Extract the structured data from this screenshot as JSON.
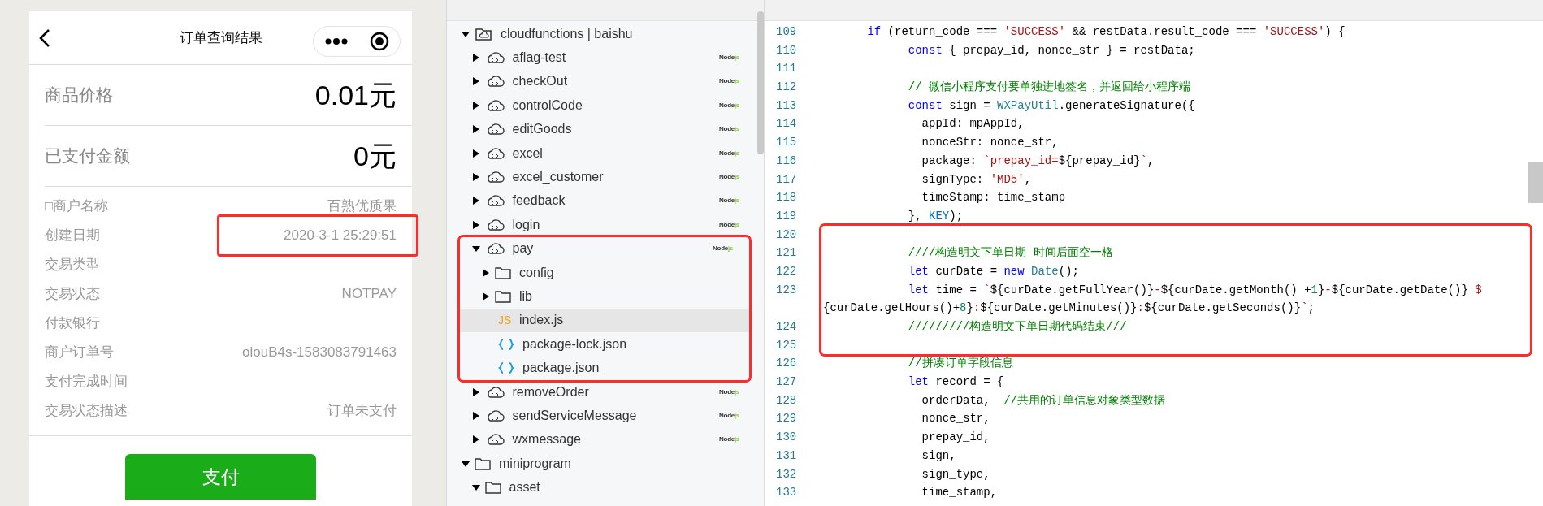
{
  "phone": {
    "title": "订单查询结果",
    "amounts": [
      {
        "label": "商品价格",
        "value": "0.01元"
      },
      {
        "label": "已支付金额",
        "value": "0元"
      }
    ],
    "details": [
      {
        "label": "□商户名称",
        "value": "百熟优质果",
        "highlighted": false
      },
      {
        "label": "创建日期",
        "value": "2020-3-1 25:29:51",
        "highlighted": true
      },
      {
        "label": "交易类型",
        "highlighted": false
      },
      {
        "label": "交易状态",
        "value": "NOTPAY",
        "highlighted": false
      },
      {
        "label": "付款银行",
        "highlighted": false
      },
      {
        "label": "商户订单号",
        "value": "olouB4s-1583083791463",
        "highlighted": false
      },
      {
        "label": "支付完成时间",
        "highlighted": false
      },
      {
        "label": "交易状态描述",
        "value": "订单未支付",
        "highlighted": false
      }
    ],
    "pay_button": "支付"
  },
  "file_tree": [
    {
      "label": "cloudfunctions | baishu",
      "kind": "cloud-root",
      "expanded": true,
      "selected": false,
      "children": [
        {
          "label": "aflag-test",
          "kind": "function",
          "expanded": false,
          "selected": false,
          "highlighted": false,
          "badge": {
            "name": "Node",
            "suffix": "js"
          }
        },
        {
          "label": "checkOut",
          "kind": "function",
          "expanded": false,
          "selected": false,
          "highlighted": false,
          "badge": {
            "name": "Node",
            "suffix": "js"
          }
        },
        {
          "label": "controlCode",
          "kind": "function",
          "expanded": false,
          "selected": false,
          "highlighted": false,
          "badge": {
            "name": "Node",
            "suffix": "js"
          }
        },
        {
          "label": "editGoods",
          "kind": "function",
          "expanded": false,
          "selected": false,
          "highlighted": false,
          "badge": {
            "name": "Node",
            "suffix": "js"
          }
        },
        {
          "label": "excel",
          "kind": "function",
          "expanded": false,
          "selected": false,
          "highlighted": false,
          "badge": {
            "name": "Node",
            "suffix": "js"
          }
        },
        {
          "label": "excel_customer",
          "kind": "function",
          "expanded": false,
          "selected": false,
          "highlighted": false,
          "badge": {
            "name": "Node",
            "suffix": "js"
          }
        },
        {
          "label": "feedback",
          "kind": "function",
          "expanded": false,
          "selected": false,
          "highlighted": false,
          "badge": {
            "name": "Node",
            "suffix": "js"
          }
        },
        {
          "label": "login",
          "kind": "function",
          "expanded": false,
          "selected": false,
          "highlighted": false,
          "badge": {
            "name": "Node",
            "suffix": "js"
          }
        },
        {
          "label": "pay",
          "kind": "function",
          "expanded": true,
          "selected": false,
          "highlighted": true,
          "badge": {
            "name": "Node",
            "suffix": "js"
          },
          "children": [
            {
              "label": "config",
              "kind": "folder",
              "expanded": false,
              "selected": false
            },
            {
              "label": "lib",
              "kind": "folder",
              "expanded": false,
              "selected": false
            },
            {
              "label": "index.js",
              "kind": "js",
              "icon_text": "JS",
              "selected": true
            },
            {
              "label": "package-lock.json",
              "kind": "json",
              "selected": false
            },
            {
              "label": "package.json",
              "kind": "json",
              "selected": false
            }
          ]
        },
        {
          "label": "removeOrder",
          "kind": "function",
          "expanded": false,
          "selected": false,
          "highlighted": false,
          "badge": {
            "name": "Node",
            "suffix": "js"
          }
        },
        {
          "label": "sendServiceMessage",
          "kind": "function",
          "expanded": false,
          "selected": false,
          "highlighted": false,
          "badge": {
            "name": "Node",
            "suffix": "js"
          }
        },
        {
          "label": "wxmessage",
          "kind": "function",
          "expanded": false,
          "selected": false,
          "highlighted": false,
          "badge": {
            "name": "Node",
            "suffix": "js"
          }
        }
      ]
    },
    {
      "label": "miniprogram",
      "kind": "folder",
      "expanded": true,
      "selected": false,
      "children": [
        {
          "label": "asset",
          "kind": "folder",
          "expanded": true,
          "selected": false
        }
      ]
    }
  ],
  "code": {
    "lines": [
      {
        "number": "109",
        "highlighted": false,
        "tokens": [
          {
            "text": "      if",
            "kind": "keyword"
          },
          {
            "text": " (return_code === ",
            "kind": "plain"
          },
          {
            "text": "'SUCCESS'",
            "kind": "string"
          },
          {
            "text": " && restData.result_code === ",
            "kind": "plain"
          },
          {
            "text": "'SUCCESS'",
            "kind": "string"
          },
          {
            "text": ") {",
            "kind": "plain"
          }
        ]
      },
      {
        "number": "110",
        "highlighted": false,
        "tokens": [
          {
            "text": "            const",
            "kind": "keyword"
          },
          {
            "text": " { prepay_id, nonce_str } = restData;",
            "kind": "plain"
          }
        ]
      },
      {
        "number": "111",
        "highlighted": false
      },
      {
        "number": "112",
        "highlighted": false,
        "tokens": [
          {
            "text": "            // 微信小程序支付要单独进地签名，并返回给小程序端",
            "kind": "comment"
          }
        ]
      },
      {
        "number": "113",
        "highlighted": false,
        "tokens": [
          {
            "text": "            const",
            "kind": "keyword"
          },
          {
            "text": " sign = ",
            "kind": "plain"
          },
          {
            "text": "WXPayUtil",
            "kind": "type"
          },
          {
            "text": ".generateSignature({",
            "kind": "plain"
          }
        ]
      },
      {
        "number": "114",
        "highlighted": false,
        "tokens": [
          {
            "text": "              appId: mpAppId,",
            "kind": "plain"
          }
        ]
      },
      {
        "number": "115",
        "highlighted": false,
        "tokens": [
          {
            "text": "              nonceStr: nonce_str,",
            "kind": "plain"
          }
        ]
      },
      {
        "number": "116",
        "highlighted": false,
        "tokens": [
          {
            "text": "              package: ",
            "kind": "plain"
          },
          {
            "text": "`prepay_id=",
            "kind": "string"
          },
          {
            "text": "${prepay_id}",
            "kind": "plain"
          },
          {
            "text": "`",
            "kind": "string"
          },
          {
            "text": ",",
            "kind": "plain"
          }
        ]
      },
      {
        "number": "117",
        "highlighted": false,
        "tokens": [
          {
            "text": "              signType: ",
            "kind": "plain"
          },
          {
            "text": "'MD5'",
            "kind": "string"
          },
          {
            "text": ",",
            "kind": "plain"
          }
        ]
      },
      {
        "number": "118",
        "highlighted": false,
        "tokens": [
          {
            "text": "              timeStamp: time_stamp",
            "kind": "plain"
          }
        ]
      },
      {
        "number": "119",
        "highlighted": false,
        "tokens": [
          {
            "text": "            }, ",
            "kind": "plain"
          },
          {
            "text": "KEY",
            "kind": "constant"
          },
          {
            "text": ");",
            "kind": "plain"
          }
        ]
      },
      {
        "number": "120",
        "highlighted": true
      },
      {
        "number": "121",
        "highlighted": true,
        "tokens": [
          {
            "text": "            ////构造明文下单日期 时间后面空一格",
            "kind": "comment"
          }
        ]
      },
      {
        "number": "122",
        "highlighted": true,
        "tokens": [
          {
            "text": "            let",
            "kind": "keyword"
          },
          {
            "text": " curDate = ",
            "kind": "plain"
          },
          {
            "text": "new",
            "kind": "keyword"
          },
          {
            "text": " Date",
            "kind": "type"
          },
          {
            "text": "();",
            "kind": "plain"
          }
        ]
      },
      {
        "number": "123",
        "highlighted": true,
        "tokens": [
          {
            "text": "            let",
            "kind": "keyword"
          },
          {
            "text": " time = ",
            "kind": "plain"
          },
          {
            "text": "`",
            "kind": "string"
          },
          {
            "text": "${curDate.getFullYear()}",
            "kind": "plain"
          },
          {
            "text": "-",
            "kind": "string"
          },
          {
            "text": "${curDate.getMonth() +",
            "kind": "plain"
          },
          {
            "text": "1",
            "kind": "number"
          },
          {
            "text": "}",
            "kind": "plain"
          },
          {
            "text": "-",
            "kind": "string"
          },
          {
            "text": "${curDate.getDate()}",
            "kind": "plain"
          },
          {
            "text": " $",
            "kind": "string"
          }
        ],
        "wrap": [
          {
            "text": "{curDate.getHours()+",
            "kind": "plain"
          },
          {
            "text": "8",
            "kind": "number"
          },
          {
            "text": "}",
            "kind": "plain"
          },
          {
            "text": ":",
            "kind": "string"
          },
          {
            "text": "${curDate.getMinutes()}",
            "kind": "plain"
          },
          {
            "text": ":",
            "kind": "string"
          },
          {
            "text": "${curDate.getSeconds()}",
            "kind": "plain"
          },
          {
            "text": "`",
            "kind": "string"
          },
          {
            "text": ";",
            "kind": "plain"
          }
        ]
      },
      {
        "number": "124",
        "highlighted": true,
        "tokens": [
          {
            "text": "            /////////构造明文下单日期代码结束///",
            "kind": "comment"
          }
        ]
      },
      {
        "number": "125",
        "highlighted": true
      },
      {
        "number": "126",
        "highlighted": false,
        "tokens": [
          {
            "text": "            //拼凑订单字段信息",
            "kind": "comment"
          }
        ]
      },
      {
        "number": "127",
        "highlighted": false,
        "tokens": [
          {
            "text": "            let",
            "kind": "keyword"
          },
          {
            "text": " record = {",
            "kind": "plain"
          }
        ]
      },
      {
        "number": "128",
        "highlighted": false,
        "tokens": [
          {
            "text": "              orderData,  ",
            "kind": "plain"
          },
          {
            "text": "//共用的订单信息对象类型数据",
            "kind": "comment"
          }
        ]
      },
      {
        "number": "129",
        "highlighted": false,
        "tokens": [
          {
            "text": "              nonce_str,",
            "kind": "plain"
          }
        ]
      },
      {
        "number": "130",
        "highlighted": false,
        "tokens": [
          {
            "text": "              prepay_id,",
            "kind": "plain"
          }
        ]
      },
      {
        "number": "131",
        "highlighted": false,
        "tokens": [
          {
            "text": "              sign,",
            "kind": "plain"
          }
        ]
      },
      {
        "number": "132",
        "highlighted": false,
        "tokens": [
          {
            "text": "              sign_type,",
            "kind": "plain"
          }
        ]
      },
      {
        "number": "133",
        "highlighted": false,
        "tokens": [
          {
            "text": "              time_stamp,",
            "kind": "plain"
          }
        ]
      }
    ]
  }
}
